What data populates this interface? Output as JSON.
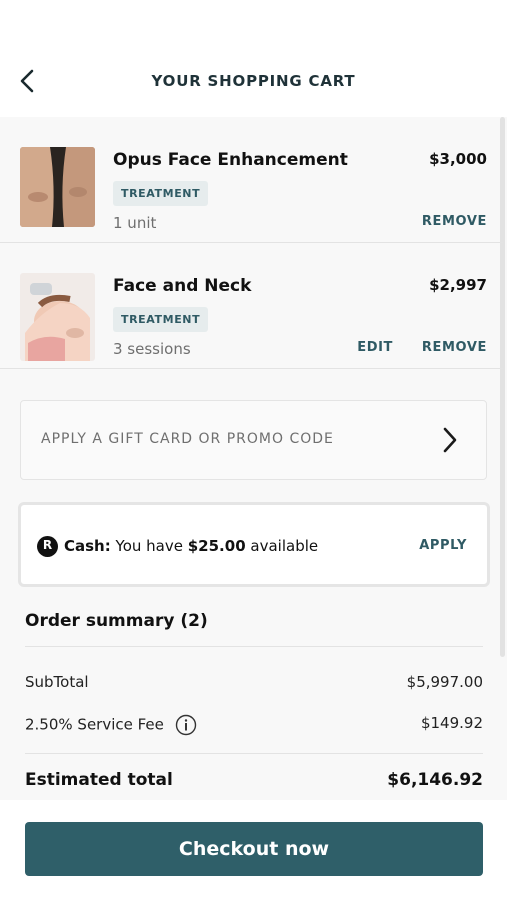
{
  "header": {
    "title": "YOUR SHOPPING CART",
    "back_icon": "chevron-left-icon"
  },
  "cart": {
    "items": [
      {
        "title": "Opus Face Enhancement",
        "price": "$3,000",
        "badge": "TREATMENT",
        "quantity": "1 unit",
        "remove_label": "REMOVE",
        "image": "face-closeup-photo"
      },
      {
        "title": "Face and Neck",
        "price": "$2,997",
        "badge": "TREATMENT",
        "quantity": "3 sessions",
        "edit_label": "EDIT",
        "remove_label": "REMOVE",
        "image": "facial-treatment-photo"
      }
    ]
  },
  "promo": {
    "label": "APPLY A GIFT CARD OR PROMO CODE",
    "icon": "chevron-right-icon"
  },
  "cash": {
    "logo_letter": "R",
    "label": "Cash:",
    "text_before": "You have",
    "amount": "$25.00",
    "text_after": "available",
    "apply_label": "APPLY"
  },
  "summary": {
    "title": "Order summary (2)",
    "subtotal_label": "SubTotal",
    "subtotal_value": "$5,997.00",
    "fee_label": "2.50% Service Fee",
    "fee_value": "$149.92",
    "fee_icon": "info-icon",
    "total_label": "Estimated total",
    "total_value": "$6,146.92"
  },
  "footer": {
    "checkout_label": "Checkout now"
  },
  "colors": {
    "accent": "#2f5f69",
    "badge_bg": "#e6eced",
    "action_text": "#2f5a64"
  }
}
